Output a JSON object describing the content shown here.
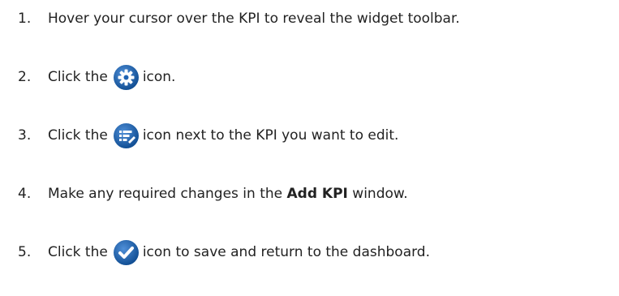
{
  "steps": [
    {
      "number": "1.",
      "text": "Hover your cursor over the KPI to reveal the widget toolbar."
    },
    {
      "number": "2.",
      "before": "Click the",
      "icon": "gear-icon",
      "after": "icon."
    },
    {
      "number": "3.",
      "before": "Click the",
      "icon": "edit-list-icon",
      "after": "icon next to the KPI you want to edit."
    },
    {
      "number": "4.",
      "before": "Make any required changes in the",
      "bold": "Add KPI",
      "after": "window."
    },
    {
      "number": "5.",
      "before": "Click the",
      "icon": "checkmark-icon",
      "after": "icon to save and return to the dashboard."
    }
  ],
  "colors": {
    "text": "#222222",
    "icon_fill": "#1f63b3",
    "icon_dark": "#0d4a8f",
    "icon_glyph": "#ffffff"
  }
}
